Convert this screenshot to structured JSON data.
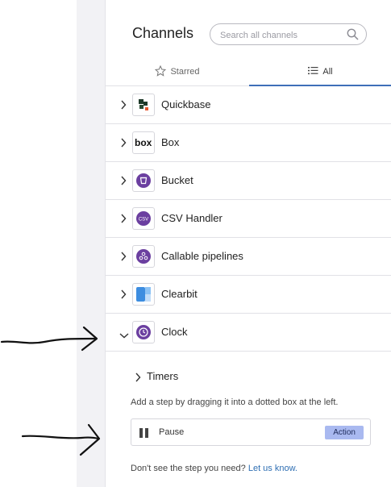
{
  "header": {
    "title": "Channels",
    "search_placeholder": "Search all channels"
  },
  "tabs": [
    {
      "label": "Starred",
      "icon": "star-icon",
      "selected": false
    },
    {
      "label": "All",
      "icon": "list-icon",
      "selected": true
    }
  ],
  "channels": [
    {
      "name": "Quickbase",
      "logo": "quickbase-logo",
      "expanded": false
    },
    {
      "name": "Box",
      "logo": "box-logo",
      "expanded": false
    },
    {
      "name": "Bucket",
      "logo": "bucket-logo",
      "expanded": false
    },
    {
      "name": "CSV Handler",
      "logo": "csv-logo",
      "logo_text": "CSV",
      "expanded": false
    },
    {
      "name": "Callable pipelines",
      "logo": "pipelines-logo",
      "expanded": false
    },
    {
      "name": "Clearbit",
      "logo": "clearbit-logo",
      "expanded": false
    },
    {
      "name": "Clock",
      "logo": "clock-logo",
      "expanded": true
    }
  ],
  "clock_section": {
    "group_label": "Timers",
    "hint": "Add a step by dragging it into a dotted box at the left.",
    "step": {
      "label": "Pause",
      "badge": "Action",
      "icon": "pause-icon"
    },
    "footer_text": "Don't see the step you need?",
    "footer_link": "Let us know."
  },
  "colors": {
    "accent": "#3f6fb8",
    "badge": "#a9b9f0",
    "purple": "#6b3fa0",
    "link": "#2f6fb3"
  }
}
